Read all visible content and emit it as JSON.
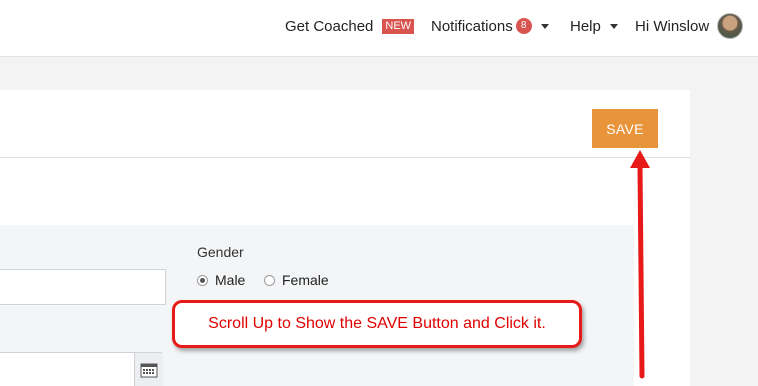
{
  "nav": {
    "get_coached": "Get Coached",
    "new_badge": "NEW",
    "notifications": "Notifications",
    "notifications_count": "8",
    "help": "Help",
    "greeting": "Hi Winslow"
  },
  "card": {
    "save_label": "SAVE"
  },
  "form": {
    "gender_label": "Gender",
    "gender_options": [
      "Male",
      "Female"
    ],
    "gender_selected": "Male"
  },
  "annotation": {
    "callout_text": "Scroll Up to Show the SAVE Button and Click it.",
    "color": "#e81919"
  },
  "colors": {
    "save_button": "#e8943a",
    "badge": "#d9534f"
  }
}
